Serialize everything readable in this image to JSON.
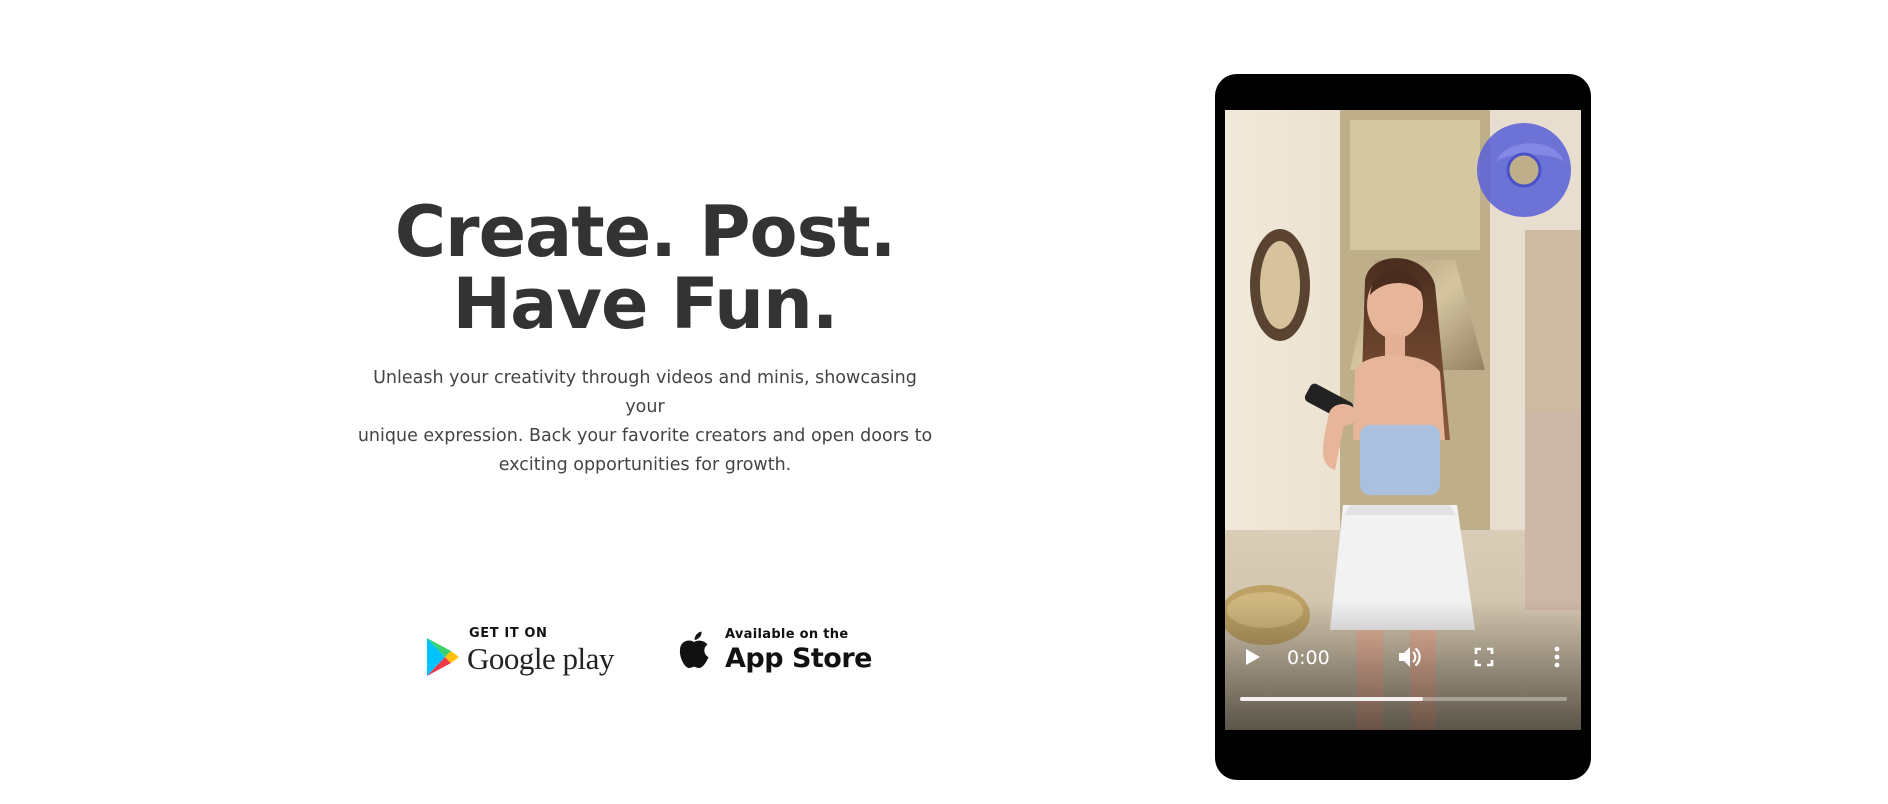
{
  "hero": {
    "title_line1": "Create. Post.",
    "title_line2": "Have Fun.",
    "description_line1": "Unleash your creativity through videos and minis, showcasing your",
    "description_line2": "unique expression. Back your favorite creators and open doors to",
    "description_line3": "exciting opportunities for growth."
  },
  "stores": {
    "google_play": {
      "small_label": "GET IT ON",
      "big_label": "Google play",
      "icon": "google-play-icon"
    },
    "app_store": {
      "small_label": "Available on the",
      "big_label": "App Store",
      "icon": "apple-icon"
    }
  },
  "video_player": {
    "current_time": "0:00",
    "progress": 0.56,
    "icons": {
      "play": "play-icon",
      "volume": "volume-icon",
      "fullscreen": "fullscreen-icon",
      "more": "more-vertical-icon",
      "brand": "brand-ring-logo"
    }
  },
  "colors": {
    "heading": "#333333",
    "body_text": "#444444",
    "phone_frame": "#000000",
    "brand_logo": "#5b63d6"
  }
}
